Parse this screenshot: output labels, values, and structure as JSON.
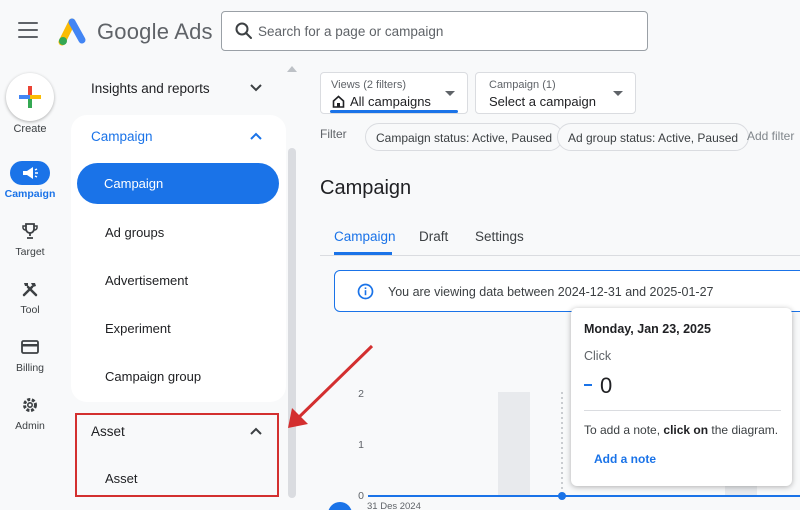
{
  "app": {
    "brand": "Google Ads"
  },
  "search": {
    "placeholder": "Search for a page or campaign"
  },
  "rail": {
    "create_label": "Create",
    "items": [
      {
        "label": "Campaign",
        "icon": "megaphone-icon",
        "active": true
      },
      {
        "label": "Target",
        "icon": "trophy-icon"
      },
      {
        "label": "Tool",
        "icon": "tools-icon"
      },
      {
        "label": "Billing",
        "icon": "card-icon"
      },
      {
        "label": "Admin",
        "icon": "gear-icon"
      }
    ]
  },
  "nav": {
    "insights_label": "Insights and reports",
    "campaign_section": "Campaign",
    "items": [
      "Campaign",
      "Ad groups",
      "Advertisement",
      "Experiment",
      "Campaign group"
    ],
    "asset_section": "Asset",
    "asset_items": [
      "Asset"
    ]
  },
  "filters": {
    "views_small": "Views (2 filters)",
    "views_value": "All campaigns",
    "campaign_small": "Campaign (1)",
    "campaign_value": "Select a campaign",
    "filter_label": "Filter",
    "chips": [
      "Campaign status: Active, Paused",
      "Ad group status: Active, Paused"
    ],
    "add_filter": "Add filter"
  },
  "main": {
    "title": "Campaign",
    "tabs": [
      "Campaign",
      "Draft",
      "Settings"
    ],
    "info_text": "You are viewing data between 2024-12-31 and 2025-01-27"
  },
  "chart_data": {
    "type": "line",
    "ylim": [
      0,
      2
    ],
    "yticks": [
      "2",
      "1",
      "0"
    ],
    "x_start_label": "31 Des 2024",
    "series": [
      {
        "values": [
          0,
          0,
          0,
          0,
          0
        ]
      }
    ]
  },
  "tooltip": {
    "date": "Monday, Jan 23, 2025",
    "metric": "Click",
    "value": "0",
    "note_pre": "To add a note, ",
    "note_bold": "click on",
    "note_post": " the diagram.",
    "add_note": "Add a note"
  },
  "colors": {
    "accent": "#1a73e8",
    "highlight": "#d32f2f"
  }
}
